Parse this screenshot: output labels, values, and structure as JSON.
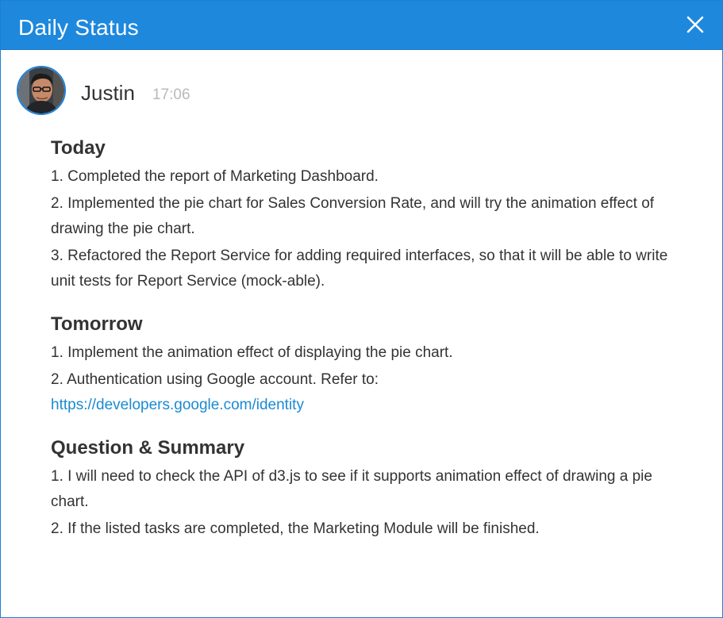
{
  "window": {
    "title": "Daily Status",
    "close_icon": "close-icon",
    "header_color": "#1E88DD"
  },
  "author": {
    "name": "Justin",
    "time": "17:06",
    "avatar_icon": "avatar"
  },
  "sections": [
    {
      "title": "Today",
      "items": [
        "1. Completed the report of Marketing Dashboard.",
        "2. Implemented the pie chart for Sales Conversion Rate, and will try the animation effect of drawing the pie chart.",
        "3. Refactored the Report Service for adding required interfaces, so that it will be able to write unit tests for Report Service (mock-able)."
      ]
    },
    {
      "title": "Tomorrow",
      "items": [
        "1. Implement the animation effect of displaying the pie chart.",
        "2. Authentication using Google account. Refer to:"
      ],
      "link": "https://developers.google.com/identity"
    },
    {
      "title": "Question & Summary",
      "items": [
        "1. I will need to check the API of d3.js to see if it supports animation effect of drawing a pie chart.",
        "2. If the listed tasks are completed, the Marketing Module will be finished."
      ]
    }
  ],
  "colors": {
    "accent": "#1E88DD",
    "link": "#1B8AD3",
    "timestamp": "#B9B9B9",
    "text": "#333333"
  }
}
